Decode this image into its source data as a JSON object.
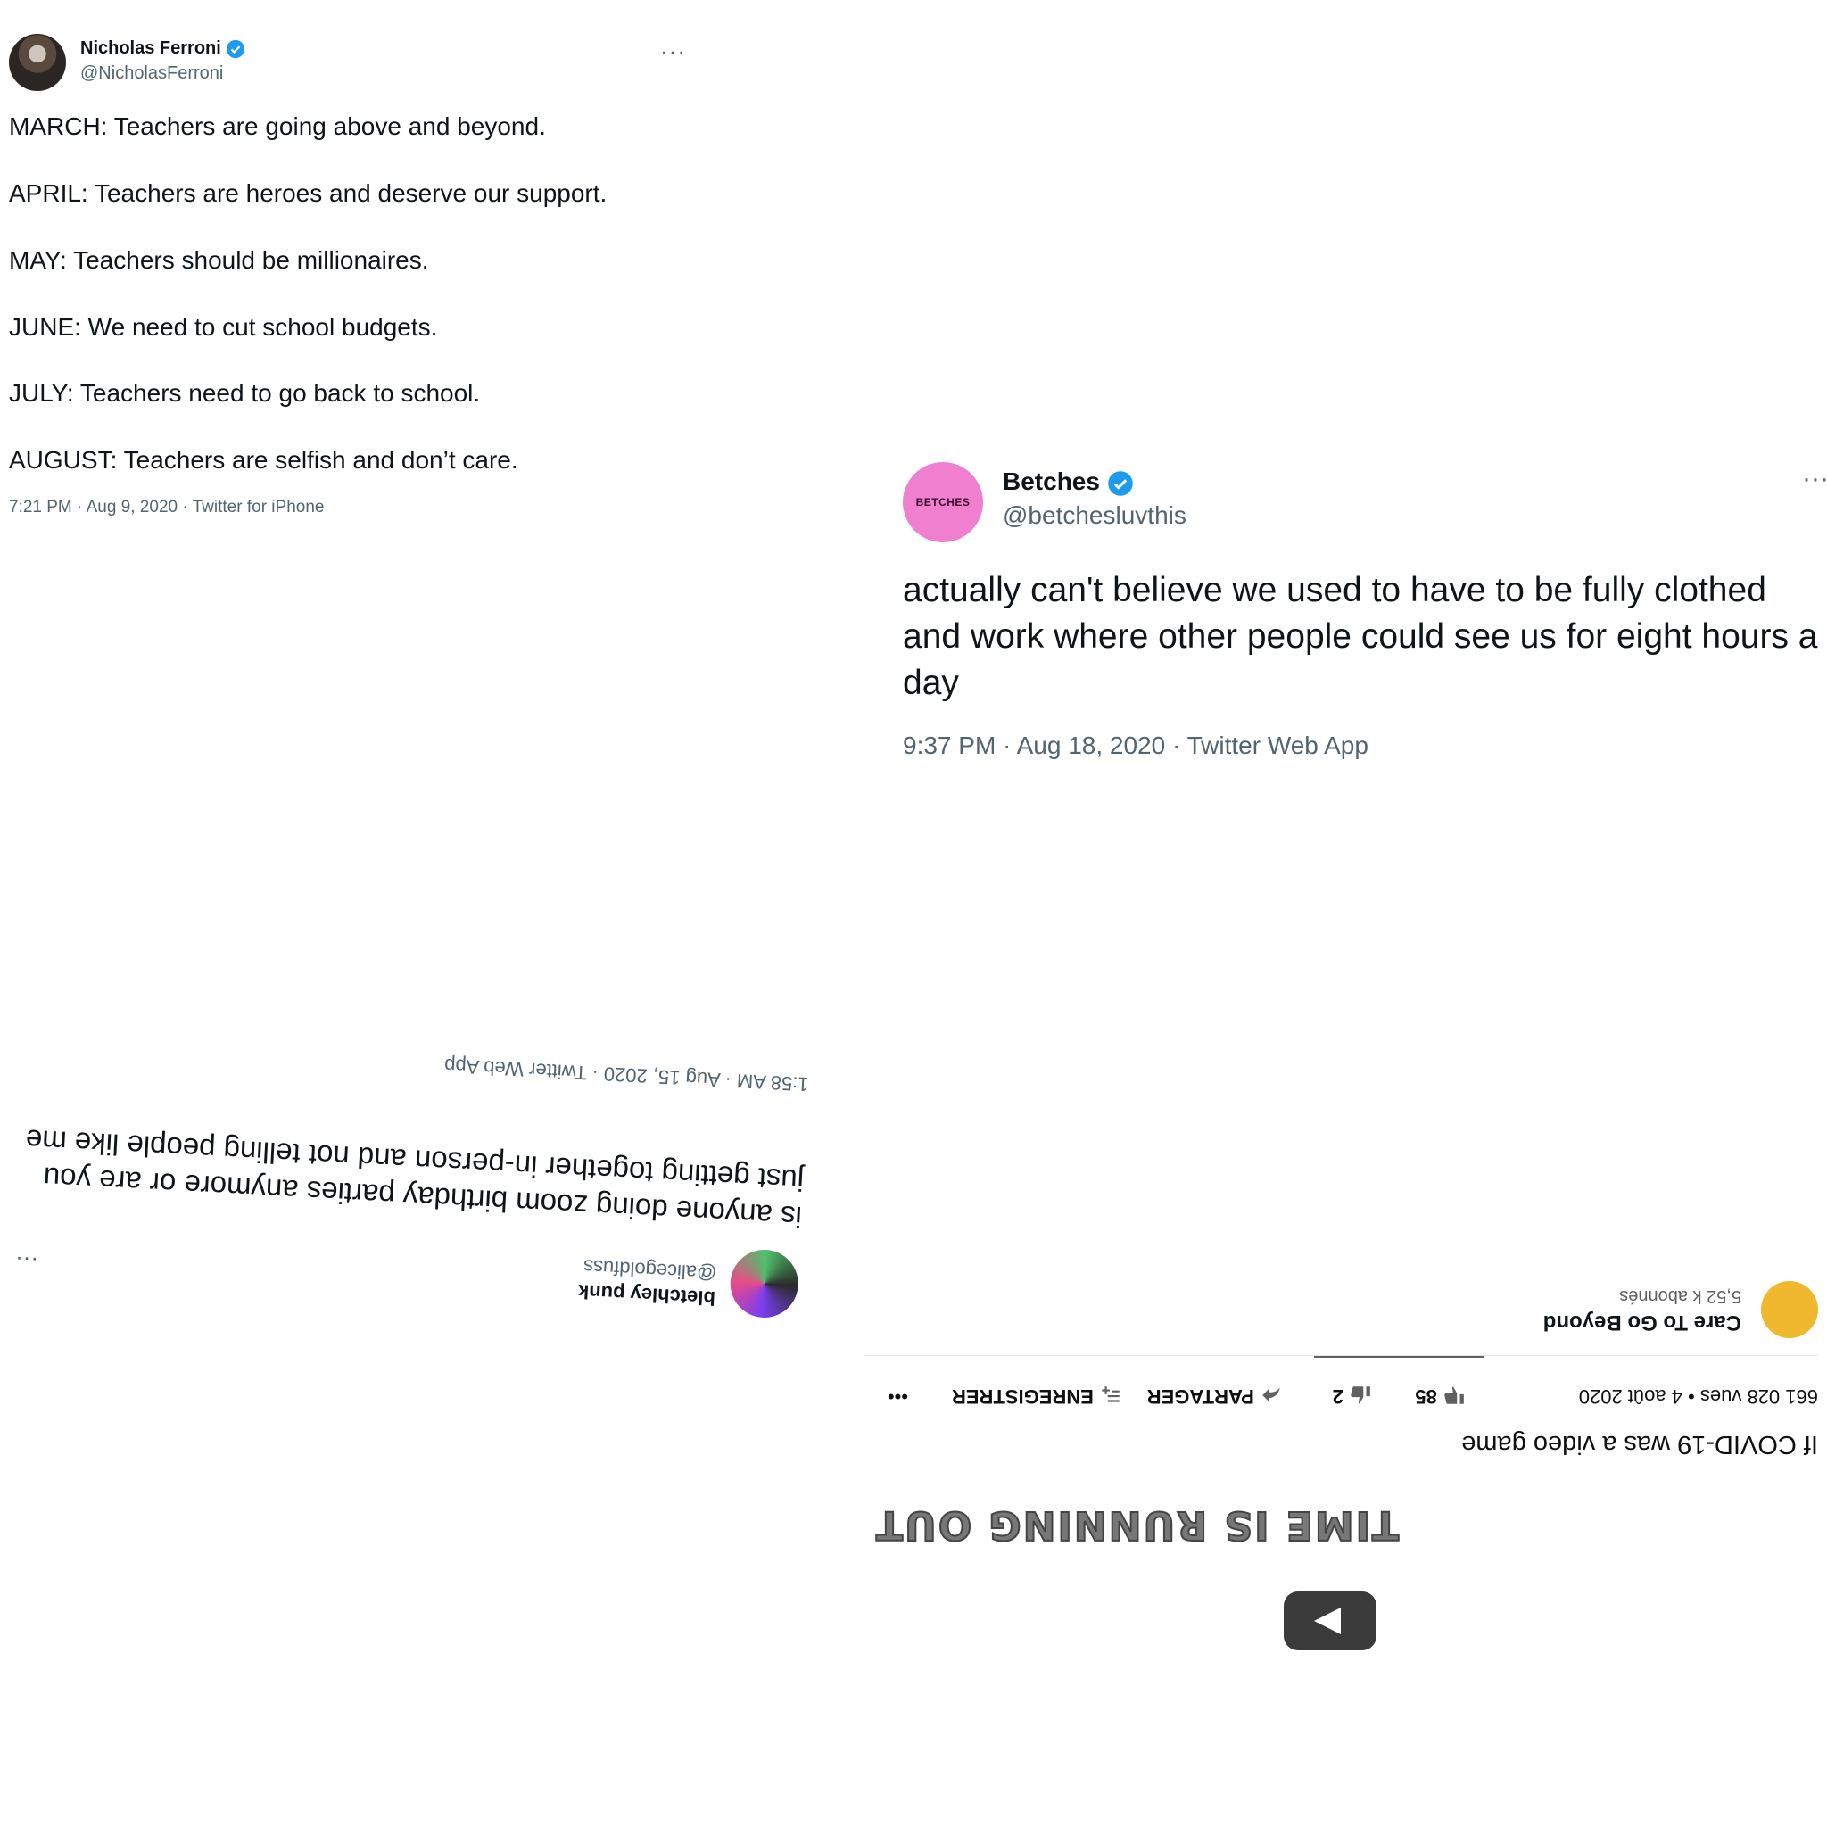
{
  "tweet1": {
    "name": "Nicholas Ferroni",
    "handle": "@NicholasFerroni",
    "more": "···",
    "lines": [
      "MARCH: Teachers are going above and beyond.",
      "APRIL: Teachers are heroes and deserve our support.",
      "MAY: Teachers should be millionaires.",
      "JUNE: We need to cut school budgets.",
      "JULY: Teachers need to go back to school.",
      "AUGUST: Teachers are selfish and don’t care."
    ],
    "meta": "7:21 PM · Aug 9, 2020 · Twitter for iPhone"
  },
  "tweet2": {
    "avatar_text": "BETCHES",
    "name": "Betches",
    "handle": "@betchesluvthis",
    "more": "···",
    "text": "actually can't believe we used to have to be fully clothed and work where other people could see us for eight hours a day",
    "meta": "9:37 PM · Aug 18, 2020 · Twitter Web App"
  },
  "tweet3": {
    "name": "bletchley punk",
    "handle": "@alicegoldfuss",
    "more": "···",
    "text": "is anyone doing zoom birthday parties anymore or are you just getting together in-person and not telling people like me",
    "meta": "1:58 AM · Aug 15, 2020 · Twitter Web App"
  },
  "youtube": {
    "video_overlay": "TIME IS RUNNING OUT",
    "title": "If COVID-19 was a video game",
    "views": "661 028 vues • 4 août 2020",
    "likes": "85",
    "dislikes": "2",
    "share": "PARTAGER",
    "save": "ENREGISTRER",
    "more": "•••",
    "channel_name": "Care To Go Beyond",
    "channel_subs": "5,52 k abonnés"
  },
  "colors": {
    "verified": "#1d9bf0",
    "betches_pink": "#f07fcf",
    "channel_gold": "#f0b82e"
  }
}
